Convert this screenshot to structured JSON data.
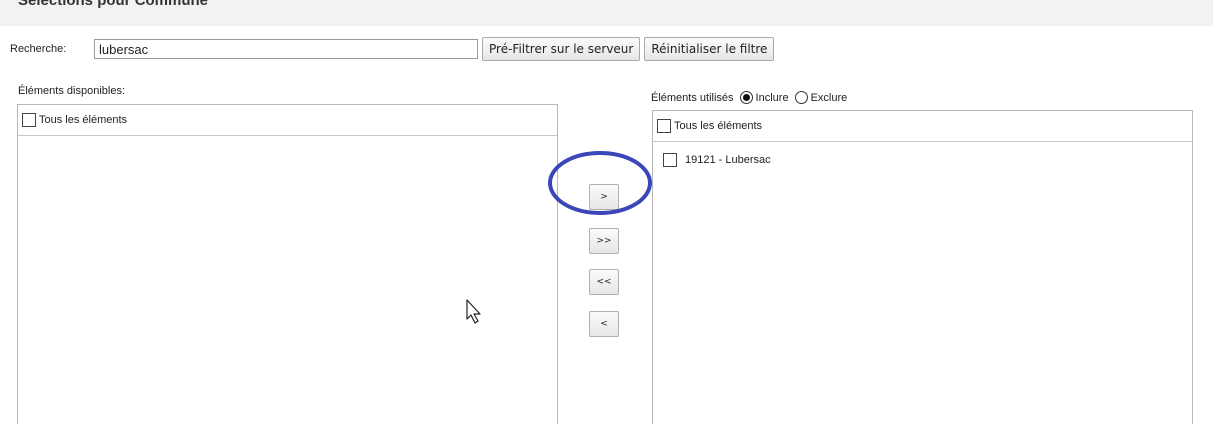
{
  "header": {
    "title": "Sélections pour Commune"
  },
  "search": {
    "label": "Recherche:",
    "value": "lubersac",
    "prefilter_label": "Pré-Filtrer sur le serveur",
    "reset_label": "Réinitialiser le filtre"
  },
  "available": {
    "label": "Éléments disponibles:",
    "select_all_label": "Tous les éléments",
    "items": []
  },
  "transfer": {
    "move_selected": ">",
    "move_all": ">>",
    "remove_all": "<<",
    "remove_selected": "<"
  },
  "used": {
    "label": "Éléments utilisés",
    "include_label": "Inclure",
    "exclude_label": "Exclure",
    "mode": "Inclure",
    "select_all_label": "Tous les éléments",
    "items": [
      {
        "label": "19121 - Lubersac",
        "checked": false
      }
    ]
  },
  "annotation": {
    "color": "#3b46b8",
    "target": "move-selected-button"
  },
  "icons": {
    "cursor": "mouse-pointer-icon"
  }
}
